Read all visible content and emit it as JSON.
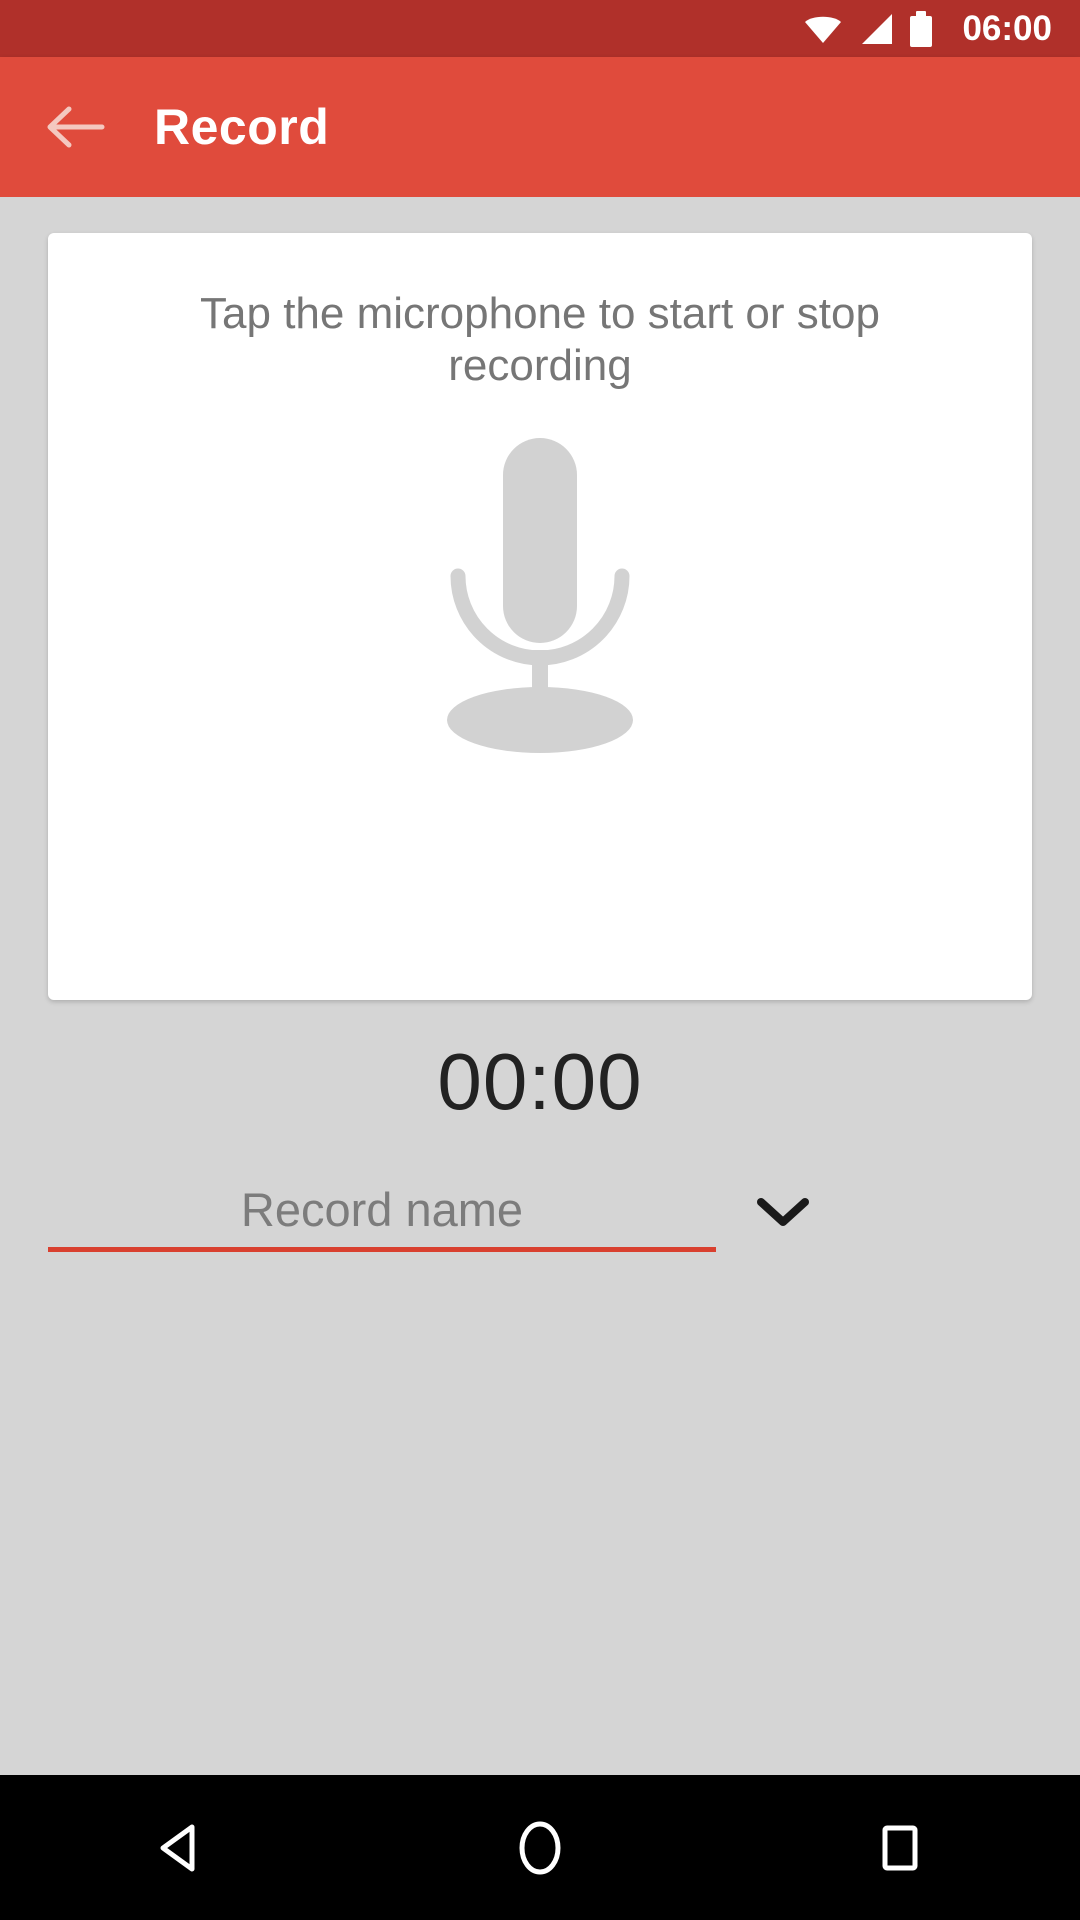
{
  "status_bar": {
    "time": "06:00",
    "icons": [
      "wifi-icon",
      "signal-icon",
      "battery-icon"
    ],
    "background_color": "#b0302a"
  },
  "app_bar": {
    "back_label": "back-arrow-icon",
    "title": "Record",
    "background_color": "#e04b3c",
    "title_color": "#ffffff"
  },
  "card": {
    "hint_text": "Tap the microphone to start or stop recording",
    "hint_color": "#767676",
    "background_color": "#ffffff",
    "mic_icon": "microphone-icon",
    "mic_color": "#d2d2d2"
  },
  "timer": {
    "value": "00:00",
    "color": "#222222"
  },
  "record_name": {
    "placeholder": "Record name",
    "value": "",
    "underline_color": "#d9402f",
    "dropdown_icon": "chevron-down-icon"
  },
  "nav_bar": {
    "background_color": "#000000",
    "buttons": [
      {
        "name": "back",
        "icon": "triangle-back-icon"
      },
      {
        "name": "home",
        "icon": "circle-home-icon"
      },
      {
        "name": "recents",
        "icon": "square-recents-icon"
      }
    ]
  },
  "screen": {
    "background_color": "#d5d5d5"
  }
}
